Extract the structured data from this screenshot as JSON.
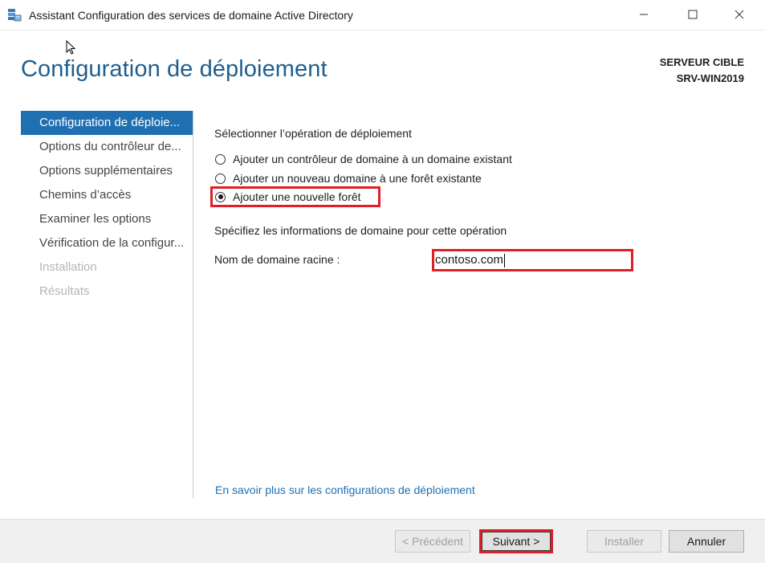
{
  "window": {
    "title": "Assistant Configuration des services de domaine Active Directory",
    "minimize_icon": "minimize-icon",
    "maximize_icon": "maximize-icon",
    "close_icon": "close-icon"
  },
  "header": {
    "page_title": "Configuration de déploiement",
    "target_label": "SERVEUR CIBLE",
    "target_name": "SRV-WIN2019"
  },
  "sidebar": {
    "items": [
      {
        "label": "Configuration de déploie...",
        "state": "active"
      },
      {
        "label": "Options du contrôleur de...",
        "state": "normal"
      },
      {
        "label": "Options supplémentaires",
        "state": "normal"
      },
      {
        "label": "Chemins d’accès",
        "state": "normal"
      },
      {
        "label": "Examiner les options",
        "state": "normal"
      },
      {
        "label": "Vérification de la configur...",
        "state": "normal"
      },
      {
        "label": "Installation",
        "state": "disabled"
      },
      {
        "label": "Résultats",
        "state": "disabled"
      }
    ]
  },
  "main": {
    "operation_heading": "Sélectionner l’opération de déploiement",
    "options": [
      {
        "label": "Ajouter un contrôleur de domaine à un domaine existant",
        "checked": false
      },
      {
        "label": "Ajouter un nouveau domaine à une forêt existante",
        "checked": false
      },
      {
        "label": "Ajouter une nouvelle forêt",
        "checked": true
      }
    ],
    "domain_heading": "Spécifiez les informations de domaine pour cette opération",
    "root_domain_label": "Nom de domaine racine :",
    "root_domain_value": "contoso.com",
    "learn_more_link": "En savoir plus sur les configurations de déploiement"
  },
  "footer": {
    "prev_label": "< Précédent",
    "next_label": "Suivant >",
    "install_label": "Installer",
    "cancel_label": "Annuler"
  },
  "colors": {
    "accent": "#1f6fb1",
    "title": "#1f5f8e",
    "highlight": "#e01e26"
  }
}
